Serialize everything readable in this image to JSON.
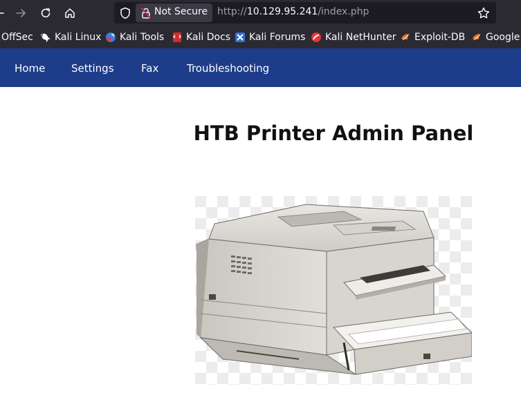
{
  "browser": {
    "security_label": "Not Secure",
    "url_scheme": "http://",
    "url_host": "10.129.95.241",
    "url_path": "/index.php",
    "icons": {
      "back": "back-arrow-icon",
      "forward": "forward-arrow-icon",
      "reload": "reload-icon",
      "home": "home-icon",
      "shield": "shield-icon",
      "lock": "insecure-lock-icon",
      "bookmark": "bookmark-star-icon"
    }
  },
  "bookmarks": [
    {
      "label": "OffSec"
    },
    {
      "label": "Kali Linux"
    },
    {
      "label": "Kali Tools"
    },
    {
      "label": "Kali Docs"
    },
    {
      "label": "Kali Forums"
    },
    {
      "label": "Kali NetHunter"
    },
    {
      "label": "Exploit-DB"
    },
    {
      "label": "Google Hacking DB"
    }
  ],
  "nav": {
    "items": [
      {
        "label": "Home"
      },
      {
        "label": "Settings"
      },
      {
        "label": "Fax"
      },
      {
        "label": "Troubleshooting"
      }
    ]
  },
  "page": {
    "title": "HTB Printer Admin Panel"
  },
  "colors": {
    "chrome": "#2b2a33",
    "urlbar": "#1c1b22",
    "nav_bg": "#1d3c8a"
  }
}
